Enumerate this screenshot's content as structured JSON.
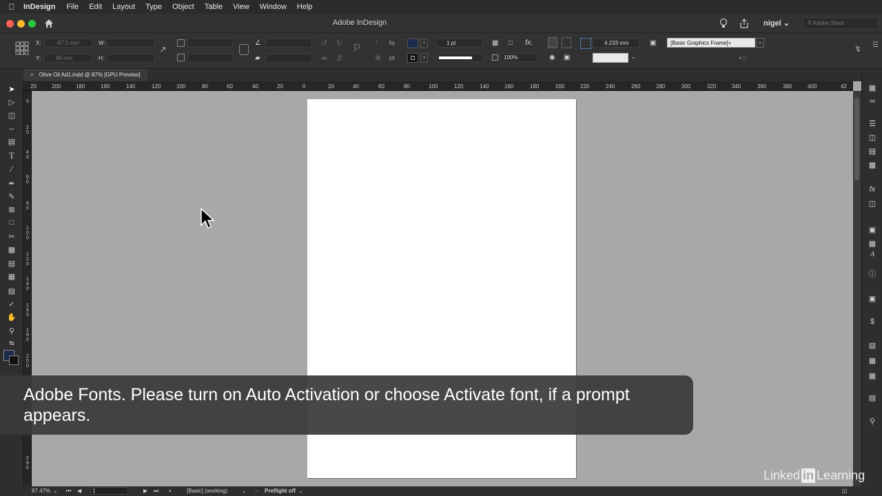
{
  "menubar": {
    "app_name": "InDesign",
    "items": [
      "File",
      "Edit",
      "Layout",
      "Type",
      "Object",
      "Table",
      "View",
      "Window",
      "Help"
    ]
  },
  "titlebar": {
    "title": "Adobe InDesign",
    "user": "nigel",
    "search_placeholder": "Adobe Stock"
  },
  "control": {
    "x_label": "X:",
    "x_value": "-87.5 mm",
    "y_label": "Y:",
    "y_value": "86 mm",
    "w_label": "W:",
    "h_label": "H:",
    "stroke_weight": "1 pt",
    "opacity": "100%",
    "offset_value": "4.233 mm",
    "object_style": "[Basic Graphics Frame]+",
    "fill_color": "#1b2a4a"
  },
  "document_tab": {
    "title": "Olive Oil Ad1.indd @ 87% [GPU Preview]"
  },
  "hruler_ticks": [
    "20",
    "200",
    "180",
    "160",
    "140",
    "120",
    "100",
    "80",
    "60",
    "40",
    "20",
    "0",
    "20",
    "40",
    "60",
    "80",
    "100",
    "120",
    "140",
    "160",
    "180",
    "200",
    "220",
    "240",
    "260",
    "280",
    "300",
    "320",
    "340",
    "360",
    "380",
    "400",
    "42"
  ],
  "vruler_ticks": [
    "0",
    "2\n0",
    "4\n0",
    "6\n0",
    "8\n0",
    "1\n0\n0",
    "1\n2\n0",
    "1\n4\n0",
    "1\n6\n0",
    "1\n8\n0",
    "2\n0\n0",
    "2\n8\n0"
  ],
  "status": {
    "zoom": "87.47%",
    "page": "1",
    "style": "[Basic] (working)",
    "preflight": "Preflight off"
  },
  "caption": {
    "text": "Adobe Fonts. Please turn on Auto Activation or choose Activate font, if a prompt appears."
  },
  "watermark": {
    "left": "Linked",
    "badge": "in",
    "right": "Learning"
  }
}
